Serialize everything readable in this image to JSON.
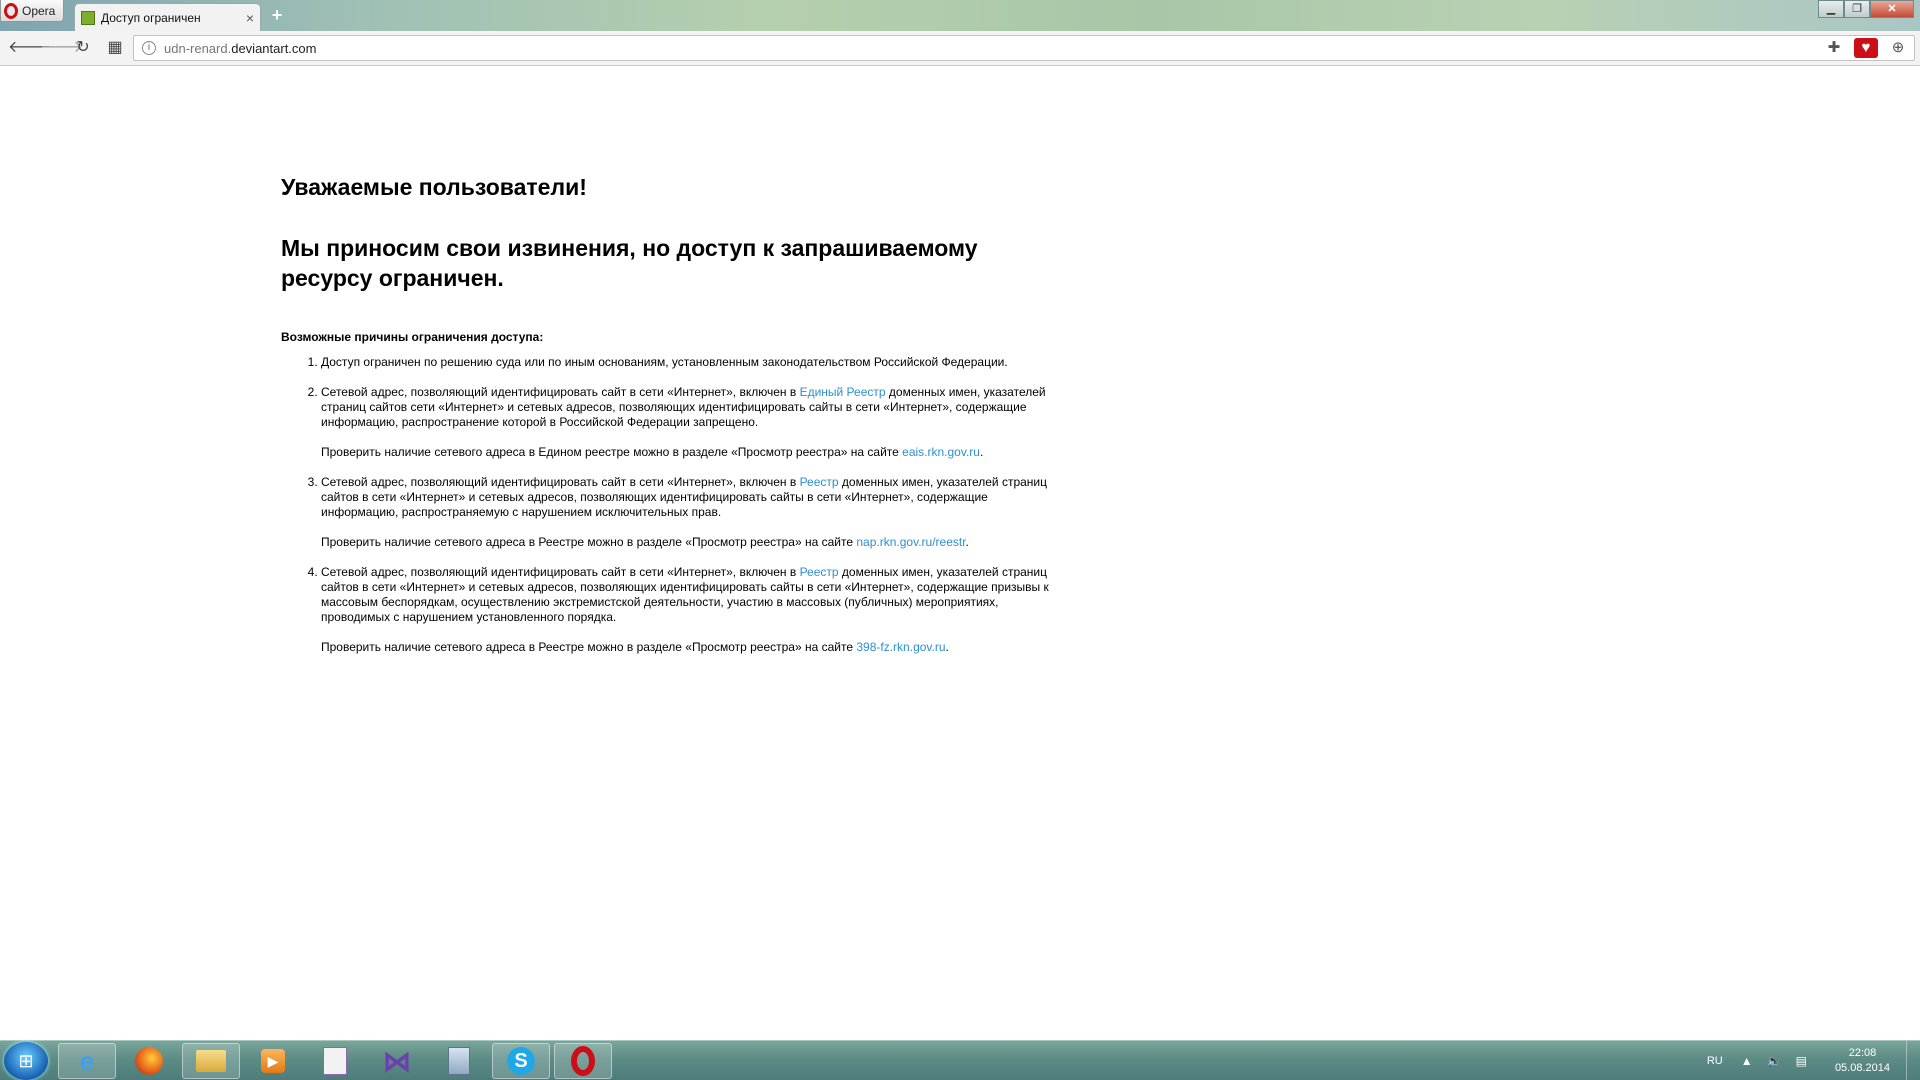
{
  "browser": {
    "menu_label": "Opera",
    "tab_title": "Доступ ограничен",
    "tab_close": "×",
    "new_tab": "+",
    "url_prefix": "udn-renard.",
    "url_domain": "deviantart.com",
    "icons": [
      "back-icon",
      "forward-icon",
      "reload-icon",
      "speed-dial-icon",
      "site-info-icon",
      "extensions-icon",
      "stash-heart-icon",
      "download-icon"
    ]
  },
  "page": {
    "greeting": "Уважаемые пользователи!",
    "apology": "Мы приносим свои извинения, но доступ к запрашиваемому ресурсу ограничен.",
    "reasons_title": "Возможные причины ограничения доступа:",
    "reason1": "Доступ ограничен  по решению суда или по иным основаниям, установленным законодательством Российской Федерации.",
    "reason2_pre": "Сетевой адрес, позволяющий идентифицировать сайт в сети «Интернет», включен в ",
    "reason2_link": "Единый Реестр",
    "reason2_post": " доменных имен, указателей страниц сайтов сети «Интернет» и сетевых адресов, позволяющих идентифицировать сайты в сети «Интернет», содержащие информацию, распространение которой в Российской Федерации запрещено.",
    "reason2_check": "Проверить наличие сетевого адреса в Едином реестре можно в разделе «Просмотр реестра» на сайте ",
    "reason2_check_link": "eais.rkn.gov.ru",
    "reason3_pre": "Сетевой адрес, позволяющий идентифицировать сайт в сети «Интернет», включен в ",
    "reason3_link": "Реестр",
    "reason3_post": " доменных имен, указателей страниц сайтов в сети «Интернет» и сетевых адресов, позволяющих идентифицировать сайты в сети «Интернет», содержащие информацию, распространяемую с нарушением исключительных прав.",
    "reason3_check": "Проверить наличие сетевого адреса в Реестре можно в разделе «Просмотр реестра» на сайте ",
    "reason3_check_link": "nap.rkn.gov.ru/reestr",
    "reason4_pre": "Сетевой адрес, позволяющий идентифицировать сайт в сети «Интернет», включен в ",
    "reason4_link": "Реестр",
    "reason4_post": " доменных имен, указателей страниц сайтов в сети «Интернет» и сетевых адресов, позволяющих идентифицировать сайты в сети «Интернет», содержащие призывы к массовым беспорядкам, осуществлению экстремистской деятельности, участию в массовых (публичных) мероприятиях, проводимых с нарушением установленного порядка.",
    "reason4_check": "Проверить наличие сетевого адреса в Реестре можно в разделе «Просмотр реестра» на сайте ",
    "reason4_check_link": "398-fz.rkn.gov.ru",
    "period": "."
  },
  "taskbar": {
    "apps": [
      "internet-explorer",
      "firefox",
      "file-explorer",
      "media-player",
      "document-app",
      "visual-studio",
      "calculator",
      "skype",
      "opera"
    ],
    "language": "RU",
    "time": "22:08",
    "date": "05.08.2014"
  },
  "colors": {
    "link": "#2d8fd0",
    "opera_red": "#cc0f16"
  }
}
